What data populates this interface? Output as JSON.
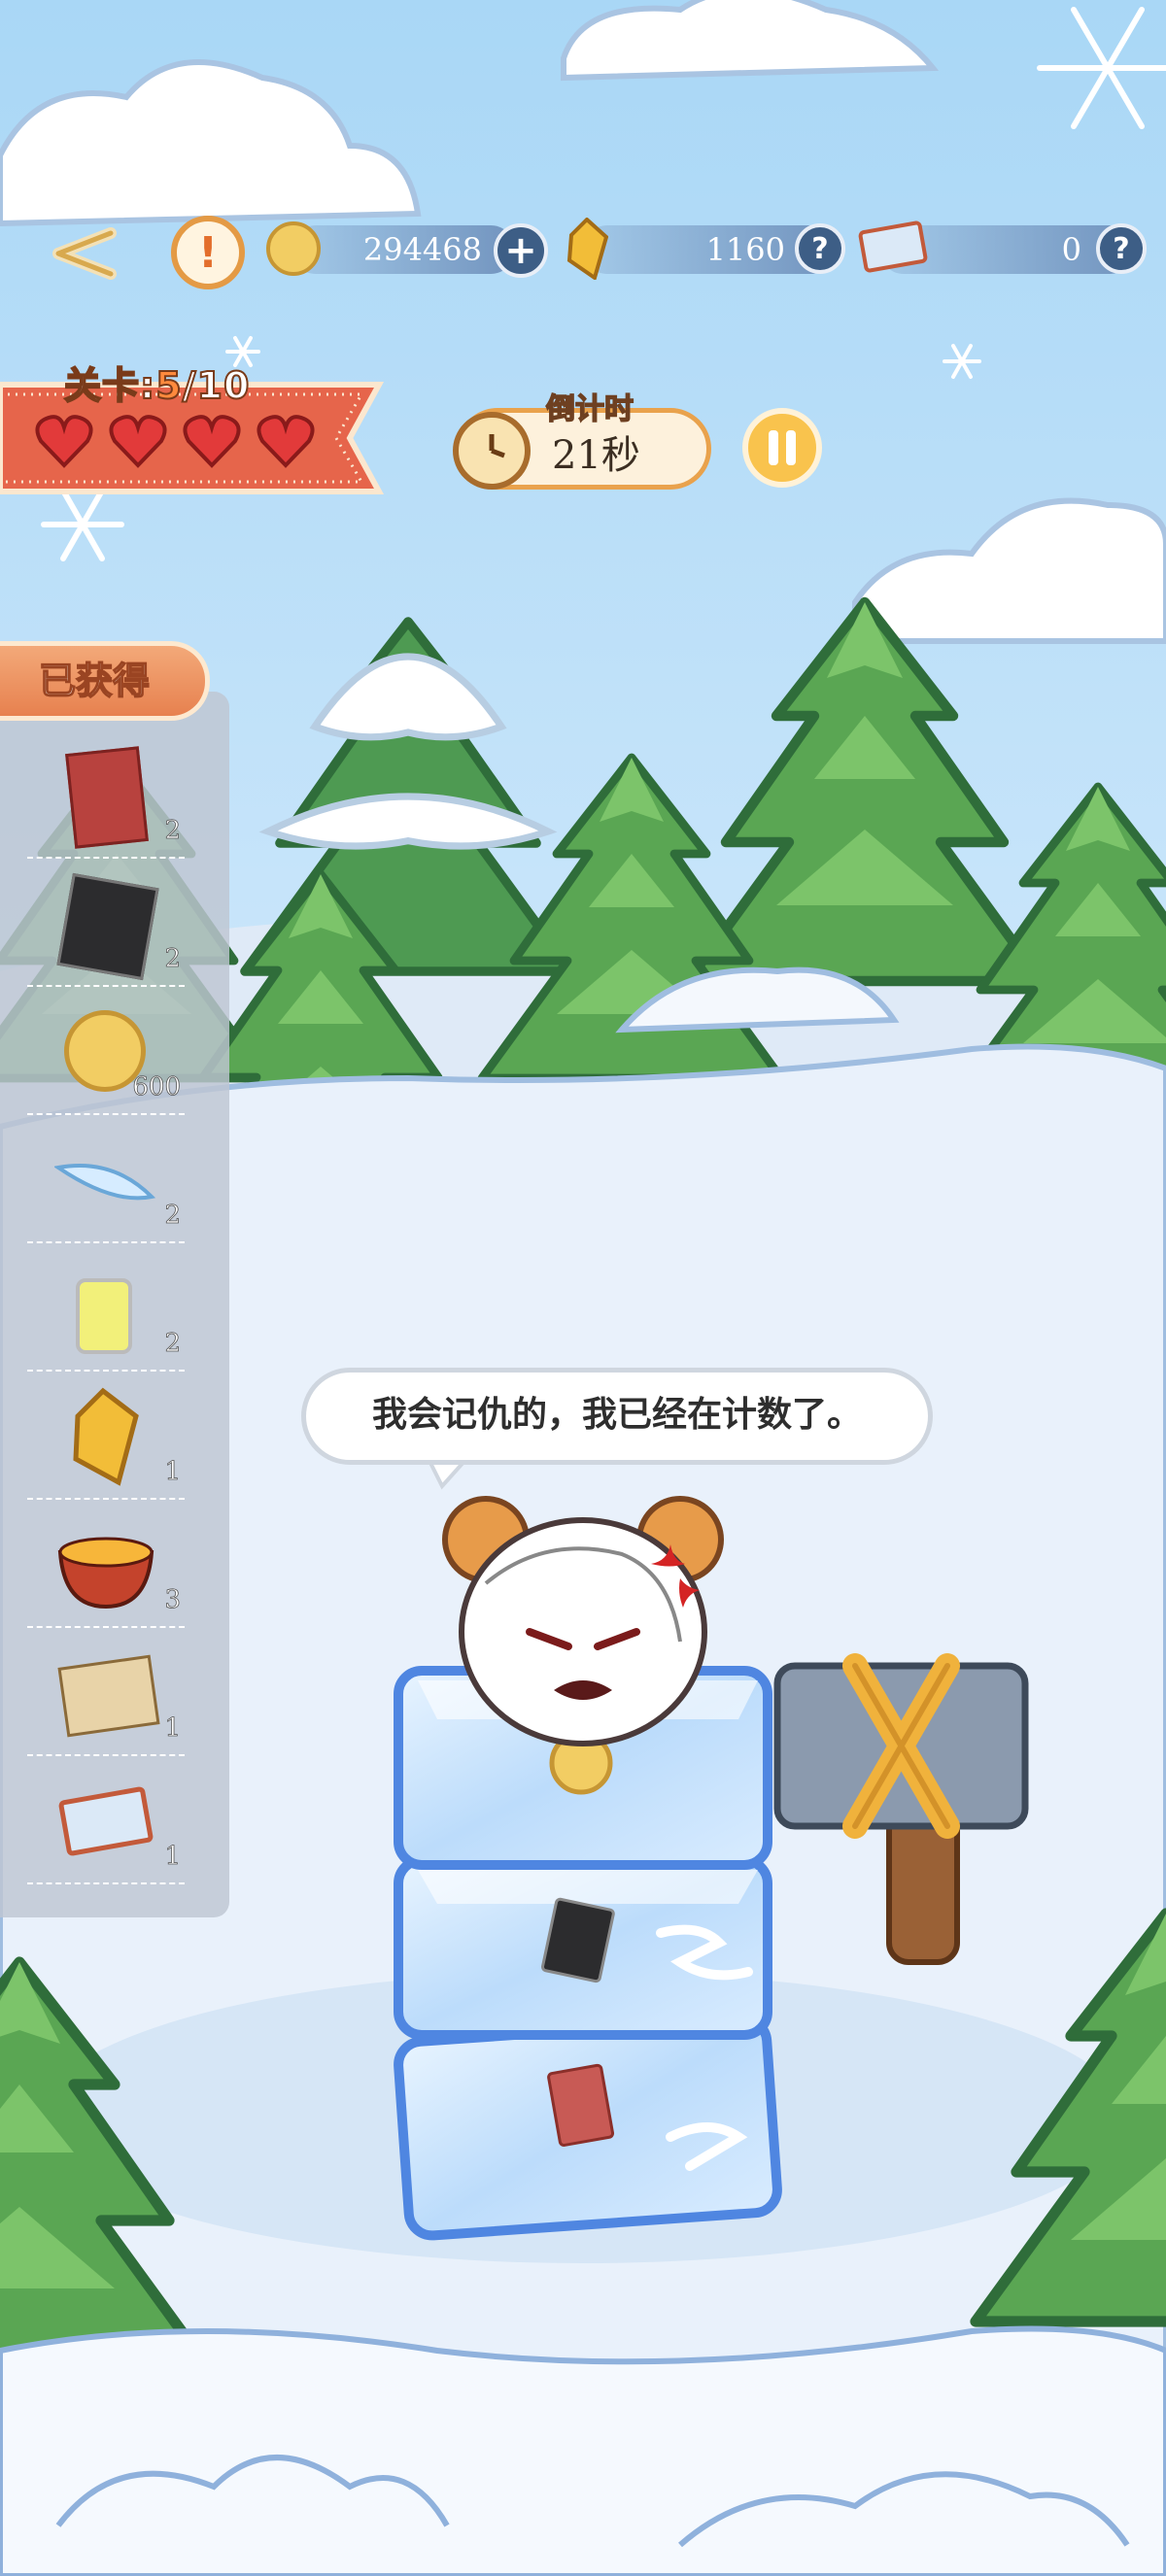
{
  "top_bar": {
    "coins": "294468",
    "crystals": "1160",
    "tickets": "0"
  },
  "level": {
    "label": "关卡:",
    "current": "5",
    "total": "/10",
    "hearts_remaining": 4
  },
  "timer": {
    "label": "倒计时",
    "value": "21秒"
  },
  "obtained": {
    "title": "已获得",
    "items": [
      {
        "icon": "red-card-icon",
        "count": "2"
      },
      {
        "icon": "black-card-icon",
        "count": "2"
      },
      {
        "icon": "gold-coin-icon",
        "count": "600"
      },
      {
        "icon": "feather-icon",
        "count": "2"
      },
      {
        "icon": "lemonade-jar-icon",
        "count": "2"
      },
      {
        "icon": "gold-crystal-icon",
        "count": "1"
      },
      {
        "icon": "ramen-bowl-icon",
        "count": "3"
      },
      {
        "icon": "envelope-icon",
        "count": "1"
      },
      {
        "icon": "ticket-icon",
        "count": "1"
      }
    ]
  },
  "dialogue": "我会记仇的，我已经在计数了。",
  "colors": {
    "sky": "#bfe1f8",
    "snow": "#eef4fb",
    "accent_orange": "#e9a24c",
    "heart_red": "#e23a3a",
    "ice_blue": "#5b8fe6"
  }
}
